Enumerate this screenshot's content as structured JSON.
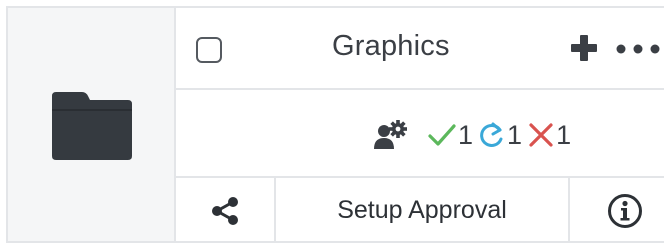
{
  "item": {
    "title": "Graphics",
    "type_icon": "folder-icon"
  },
  "header": {
    "add_icon": "plus-icon",
    "more_icon": "more-icon"
  },
  "status": {
    "workflow_icon": "user-gear-icon",
    "approved": {
      "icon": "check-icon",
      "count": "1",
      "color": "#5cb85c"
    },
    "pending": {
      "icon": "refresh-icon",
      "count": "1",
      "color": "#3aa8d8"
    },
    "rejected": {
      "icon": "x-icon",
      "count": "1",
      "color": "#d9534f"
    }
  },
  "actions": {
    "share_icon": "share-icon",
    "setup_label": "Setup Approval",
    "info_icon": "info-icon"
  },
  "colors": {
    "folder": "#353a40",
    "border": "#e3e5e8",
    "panel_bg": "#f5f6f7",
    "text": "#3b3f45"
  }
}
